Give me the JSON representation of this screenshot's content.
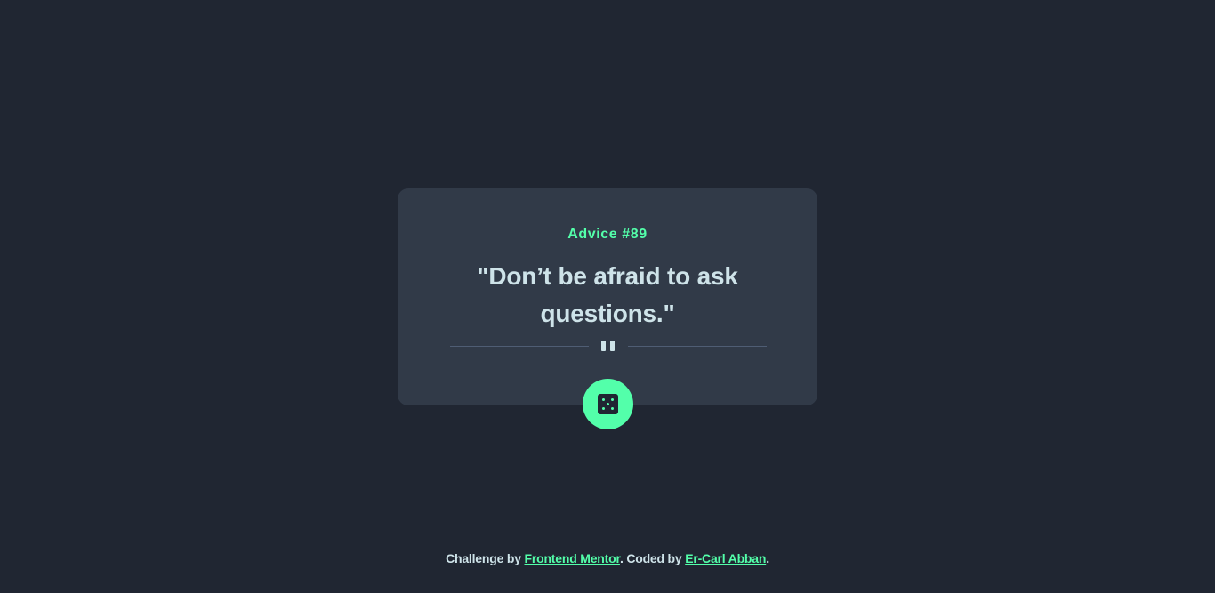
{
  "card": {
    "advice_label": "Advice #89",
    "advice_text": "\"Don’t be afraid to ask questions.\""
  },
  "icons": {
    "divider_icon": "pause-icon",
    "dice_button_icon": "dice-icon"
  },
  "footer": {
    "prefix": "Challenge by",
    "link_challenge": "Frontend Mentor",
    "middle": ". Coded by",
    "link_author": "Er-Carl Abban",
    "suffix": "."
  },
  "colors": {
    "background": "#202632",
    "card": "#313a48",
    "accent": "#53ffaa",
    "text": "#cee3e9",
    "divider": "#4f5d74"
  }
}
